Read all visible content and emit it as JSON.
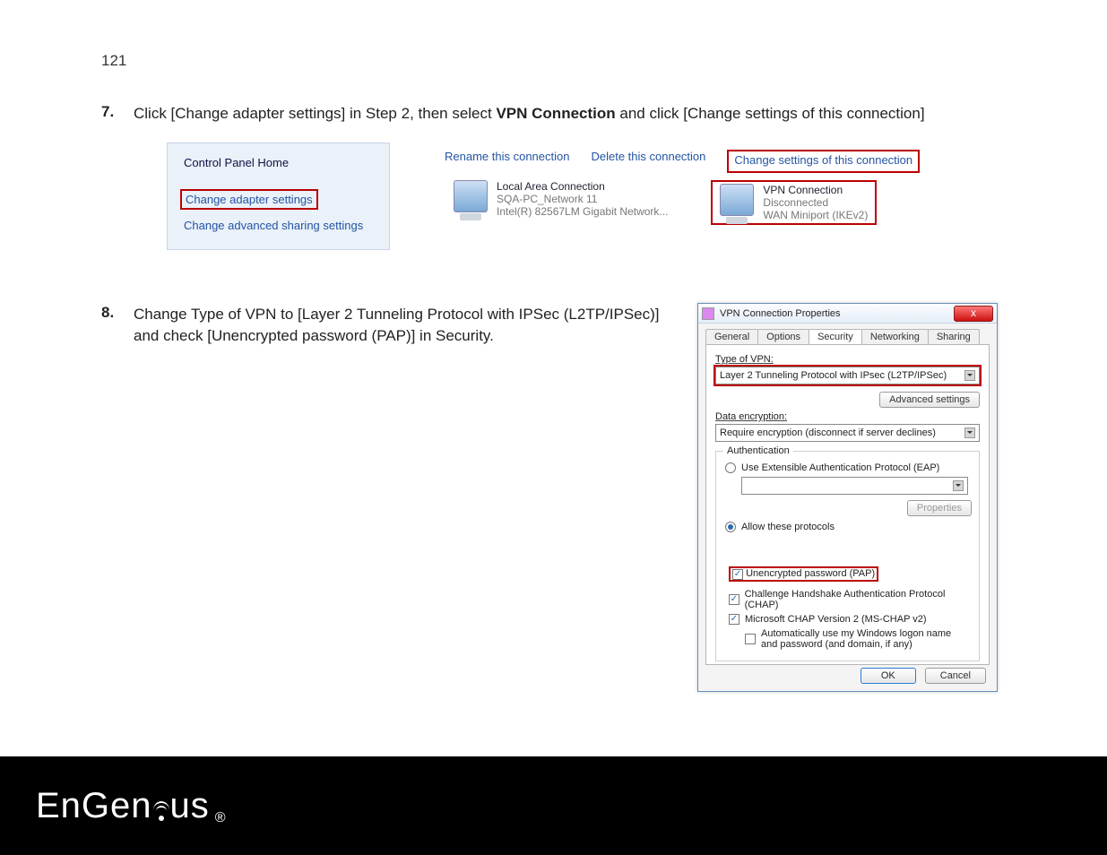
{
  "page_number": "121",
  "step7": {
    "num": "7.",
    "pre": "Click [Change adapter settings] in Step 2, then select ",
    "bold": "VPN Connection",
    "post": " and click [Change settings of this connection]"
  },
  "step8": {
    "num": "8.",
    "text": "Change Type of VPN to [Layer 2 Tunneling Protocol with IPSec (L2TP/IPSec)] and check [Unencrypted password (PAP)] in Security."
  },
  "fig1": {
    "cp_home": "Control Panel Home",
    "cp_link1": "Change adapter settings",
    "cp_link2": "Change advanced sharing settings",
    "tb": {
      "rename": "Rename this connection",
      "delete": "Delete this connection",
      "change": "Change settings of this connection"
    },
    "conn1": {
      "t1": "Local Area Connection",
      "t2": "SQA-PC_Network 11",
      "t3": "Intel(R) 82567LM Gigabit Network..."
    },
    "conn2": {
      "t1": "VPN Connection",
      "t2": "Disconnected",
      "t3": "WAN Miniport (IKEv2)"
    }
  },
  "dialog": {
    "title": "VPN Connection Properties",
    "close": "x",
    "tabs": [
      "General",
      "Options",
      "Security",
      "Networking",
      "Sharing"
    ],
    "type_label": "Type of VPN:",
    "type_value": "Layer 2 Tunneling Protocol with IPsec (L2TP/IPSec)",
    "adv_btn": "Advanced settings",
    "enc_label": "Data encryption:",
    "enc_value": "Require encryption (disconnect if server declines)",
    "auth_legend": "Authentication",
    "eap_radio": "Use Extensible Authentication Protocol (EAP)",
    "eap_props": "Properties",
    "allow_radio": "Allow these protocols",
    "pap": "Unencrypted password (PAP)",
    "chap": "Challenge Handshake Authentication Protocol (CHAP)",
    "mschap": "Microsoft CHAP Version 2 (MS-CHAP v2)",
    "autowin": "Automatically use my Windows logon name and password (and domain, if any)",
    "ok": "OK",
    "cancel": "Cancel"
  },
  "footer": {
    "brand": "EnGen",
    "brand2": "us",
    "reg": "®"
  }
}
